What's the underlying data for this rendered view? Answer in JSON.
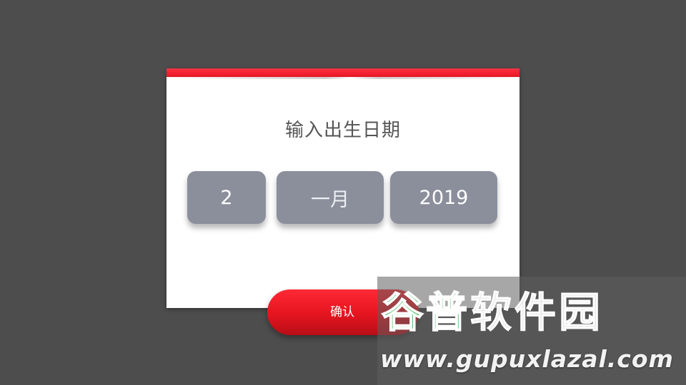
{
  "dialog": {
    "title": "输入出生日期",
    "accent_color": "#f2202e",
    "picker_color": "#8b8f9c"
  },
  "date_picker": {
    "day": "2",
    "month": "一月",
    "year": "2019"
  },
  "confirm": {
    "label": "确认"
  },
  "watermark": {
    "brand_part1": "谷普",
    "brand_part2": "软件园",
    "url": "www.gupuxlazal.com",
    "brand_color": "#1fa23a"
  }
}
